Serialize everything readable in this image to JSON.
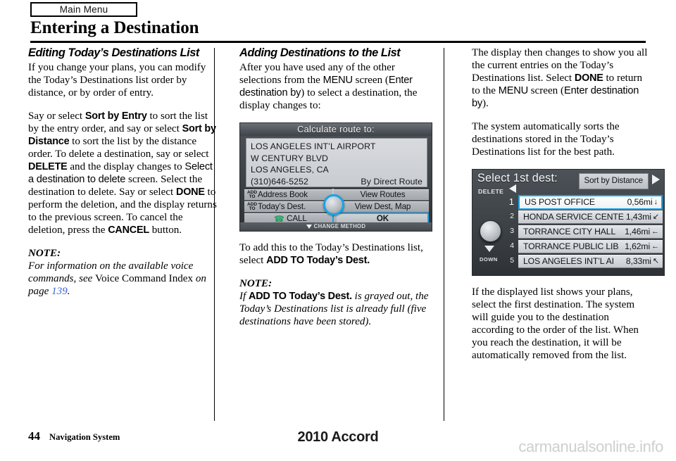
{
  "header": {
    "tab_label": "Main Menu",
    "chapter_title": "Entering a Destination"
  },
  "columns": {
    "left": {
      "heading": "Editing Today’s Destinations List",
      "para1": "If you change your plans, you can modify the Today’s Destinations list order by distance, or by order of entry.",
      "para2_a": "Say or select ",
      "para2_ui1": "Sort by Entry",
      "para2_b": " to sort the list by the entry order, and say or select ",
      "para2_ui2": "Sort by Distance",
      "para2_c": " to sort the list by the distance order. To delete a destination, say or select ",
      "para2_ui3": "DELETE",
      "para2_d": " and the display changes to ",
      "para2_ui4": "Select a destination to delete",
      "para2_e": " screen. Select the destination to delete. Say or select ",
      "para2_ui5": "DONE",
      "para2_f": " to perform the deletion, and the display returns to the previous screen. To cancel the deletion, press the ",
      "para2_ui6": "CANCEL",
      "para2_g": " button.",
      "note_label": "NOTE:",
      "note_a": "For information on the available voice commands, see ",
      "note_b": "Voice Command Index",
      "note_c": " on page ",
      "note_page": "139",
      "note_d": "."
    },
    "middle": {
      "heading": "Adding Destinations to the List",
      "para1_a": "After you have used any of the other selections from the ",
      "para1_ui1": "MENU",
      "para1_b": " screen (",
      "para1_ui2": "Enter destination by",
      "para1_c": ") to select a destination, the display changes to:",
      "para2_a": "To add this to the Today’s Destinations list, select ",
      "para2_ui1": "ADD TO Today’s Dest.",
      "note_label": "NOTE:",
      "note_a": "If ",
      "note_ui1": "ADD TO Today’s Dest.",
      "note_b": " is grayed out, the Today’s Destinations list is already full (five destinations have been stored)."
    },
    "right": {
      "para1_a": "The display then changes to show you all the current entries on the Today’s Destinations list. Select ",
      "para1_ui1": "DONE",
      "para1_b": " to return to the ",
      "para1_ui2": "MENU",
      "para1_c": " screen (",
      "para1_ui3": "Enter destination by",
      "para1_d": ").",
      "para2": "The system automatically sorts the destinations stored in the Today’s Destinations list for the best path.",
      "para3": "If the displayed list shows your plans, select the first destination. The system will guide you to the destination according to the order of the list. When you reach the destination, it will be automatically removed from the list."
    }
  },
  "navscreen_calculate_route": {
    "title": "Calculate route to:",
    "dest_name": "LOS ANGELES INT’L AIRPORT",
    "dest_street": "W CENTURY BLVD",
    "dest_city": "LOS ANGELES, CA",
    "dest_phone": "(310)646-5252",
    "route_method": "By Direct Route",
    "addto_prefix_line1": "ADD",
    "addto_prefix_line2": "TO",
    "btn_address_book": "Address Book",
    "btn_todays_dest": "Today’s Dest.",
    "btn_call": "CALL",
    "btn_view_routes": "View Routes",
    "btn_view_dest_map": "View Dest, Map",
    "btn_ok": "OK",
    "bottom_bar": "CHANGE METHOD"
  },
  "navscreen_select_dest": {
    "title": "Select 1st dest:",
    "sort_button": "Sort by Distance",
    "delete_label": "DELETE",
    "down_label": "DOWN",
    "items": [
      {
        "num": "1",
        "name": "US POST OFFICE",
        "distance": "0,56mi",
        "arrow": "↓"
      },
      {
        "num": "2",
        "name": "HONDA SERVICE CENTE",
        "distance": "1,43mi",
        "arrow": "↙"
      },
      {
        "num": "3",
        "name": "TORRANCE CITY HALL",
        "distance": "1,46mi",
        "arrow": "←"
      },
      {
        "num": "4",
        "name": "TORRANCE PUBLIC LIB",
        "distance": "1,62mi",
        "arrow": "←"
      },
      {
        "num": "5",
        "name": "LOS ANGELES INT’L AI",
        "distance": "8,33mi",
        "arrow": "↖"
      }
    ]
  },
  "footer": {
    "page_number": "44",
    "section": "Navigation System",
    "model_year": "2010 Accord",
    "watermark": "carmanualsonline.info"
  },
  "colors": {
    "highlight_blue": "#19a3e6",
    "page_link": "#3f62d8"
  }
}
